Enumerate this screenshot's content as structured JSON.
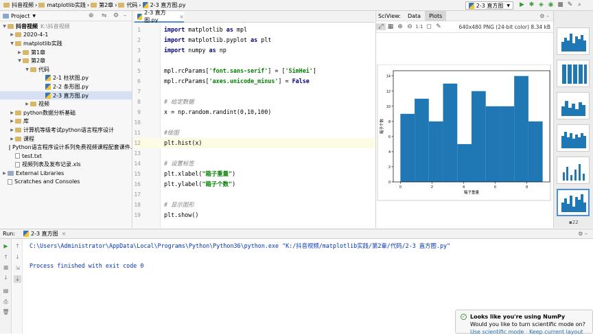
{
  "breadcrumbs": [
    "抖音视频",
    "matplotlib实践",
    "第2章",
    "代码",
    "2-3 直方图.py"
  ],
  "run_config": "2-3 直方图",
  "project": {
    "title": "Project",
    "tree": [
      {
        "label": "抖音视频",
        "sub": "K:\\抖音视频",
        "depth": 0,
        "arrow": "open",
        "icon": "folder"
      },
      {
        "label": "2020-4-1",
        "depth": 1,
        "arrow": "closed",
        "icon": "folder"
      },
      {
        "label": "matplotlib实践",
        "depth": 1,
        "arrow": "open",
        "icon": "folder"
      },
      {
        "label": "第1章",
        "depth": 2,
        "arrow": "closed",
        "icon": "folder"
      },
      {
        "label": "第2章",
        "depth": 2,
        "arrow": "open",
        "icon": "folder"
      },
      {
        "label": "代码",
        "depth": 3,
        "arrow": "open",
        "icon": "folder"
      },
      {
        "label": "2-1 柱状图.py",
        "depth": 5,
        "arrow": "",
        "icon": "py"
      },
      {
        "label": "2-2 条形图.py",
        "depth": 5,
        "arrow": "",
        "icon": "py"
      },
      {
        "label": "2-3 直方图.py",
        "depth": 5,
        "arrow": "",
        "icon": "py",
        "selected": true
      },
      {
        "label": "视频",
        "depth": 3,
        "arrow": "closed",
        "icon": "folder"
      },
      {
        "label": "python数据分析基础",
        "depth": 1,
        "arrow": "closed",
        "icon": "folder"
      },
      {
        "label": "库",
        "depth": 1,
        "arrow": "closed",
        "icon": "folder"
      },
      {
        "label": "计算机等级考试python语言程序设计",
        "depth": 1,
        "arrow": "closed",
        "icon": "folder"
      },
      {
        "label": "课程",
        "depth": 1,
        "arrow": "closed",
        "icon": "folder"
      },
      {
        "label": "Python语言程序设计系列免费视频课程配套课件.docx",
        "depth": 1,
        "arrow": "",
        "icon": "txt"
      },
      {
        "label": "test.txt",
        "depth": 1,
        "arrow": "",
        "icon": "txt"
      },
      {
        "label": "视频列表及发布记录.xls",
        "depth": 1,
        "arrow": "",
        "icon": "txt"
      },
      {
        "label": "External Libraries",
        "depth": 0,
        "arrow": "closed",
        "icon": "lib"
      },
      {
        "label": "Scratches and Consoles",
        "depth": 0,
        "arrow": "",
        "icon": "scratch"
      }
    ]
  },
  "editor": {
    "tab": "2-3 直方图.py",
    "current_line": 12,
    "lines": [
      [
        {
          "t": "import",
          "c": "kw"
        },
        {
          "t": " matplotlib "
        },
        {
          "t": "as",
          "c": "kw"
        },
        {
          "t": " mpl"
        }
      ],
      [
        {
          "t": "import",
          "c": "kw"
        },
        {
          "t": " matplotlib.pyplot "
        },
        {
          "t": "as",
          "c": "kw"
        },
        {
          "t": " plt"
        }
      ],
      [
        {
          "t": "import",
          "c": "kw"
        },
        {
          "t": " numpy "
        },
        {
          "t": "as",
          "c": "kw"
        },
        {
          "t": " np"
        }
      ],
      [],
      [
        {
          "t": "mpl.rcParams["
        },
        {
          "t": "'font.sans-serif'",
          "c": "str"
        },
        {
          "t": "] = ["
        },
        {
          "t": "'SimHei'",
          "c": "str"
        },
        {
          "t": "]"
        }
      ],
      [
        {
          "t": "mpl.rcParams["
        },
        {
          "t": "'axes.unicode_minus'",
          "c": "str"
        },
        {
          "t": "] = "
        },
        {
          "t": "False",
          "c": "kw"
        }
      ],
      [],
      [
        {
          "t": "# 给定数据",
          "c": "cm"
        }
      ],
      [
        {
          "t": "x = np.random.randint(0,10,100)"
        }
      ],
      [],
      [
        {
          "t": "#绘图",
          "c": "cm"
        }
      ],
      [
        {
          "t": "plt.hist(x)"
        }
      ],
      [],
      [
        {
          "t": "# 设置标签",
          "c": "cm"
        }
      ],
      [
        {
          "t": "plt.xlabel("
        },
        {
          "t": "\"箱子重量\"",
          "c": "str"
        },
        {
          "t": ")"
        }
      ],
      [
        {
          "t": "plt.ylabel("
        },
        {
          "t": "\"箱子个数\"",
          "c": "str"
        },
        {
          "t": ")"
        }
      ],
      [],
      [
        {
          "t": "# 显示图形",
          "c": "cm"
        }
      ],
      [
        {
          "t": "plt.show()"
        }
      ]
    ]
  },
  "sciview": {
    "title": "SciView:",
    "tabs": [
      "Data",
      "Plots"
    ],
    "active_tab": "Plots",
    "zoom_label": "1:1",
    "image_info": "640x480 PNG (24-bit color) 8.34 kB",
    "thumb_count": "22"
  },
  "chart_data": {
    "type": "bar",
    "title": "",
    "xlabel": "箱子重量",
    "ylabel": "箱子个数",
    "bins": [
      0,
      0.9,
      1.8,
      2.7,
      3.6,
      4.5,
      5.4,
      6.3,
      7.2,
      8.1,
      9.0
    ],
    "values": [
      9,
      11,
      8,
      13,
      5,
      12,
      10,
      10,
      14,
      8
    ],
    "xlim": [
      -0.45,
      9.45
    ],
    "ylim": [
      0,
      14.7
    ],
    "xticks": [
      0,
      2,
      4,
      6,
      8
    ],
    "yticks": [
      0,
      2,
      4,
      6,
      8,
      10,
      12,
      14
    ],
    "bar_color": "#1f77b4",
    "grid": false
  },
  "run": {
    "label": "Run:",
    "tab": "2-3 直方图",
    "command": "C:\\Users\\Administrator\\AppData\\Local\\Programs\\Python\\Python36\\python.exe \"K:/抖音视频/matplotlib实践/第2章/代码/2-3 直方图.py\"",
    "exit": "Process finished with exit code 0"
  },
  "notification": {
    "title": "Looks like you're using NumPy",
    "body": "Would you like to turn scientific mode on?",
    "link1": "Use scientific mode",
    "link2": "Keep current layout"
  },
  "colors": {
    "accent": "#4a8fe0",
    "bar": "#1f77b4",
    "run": "#3c9c3c"
  }
}
